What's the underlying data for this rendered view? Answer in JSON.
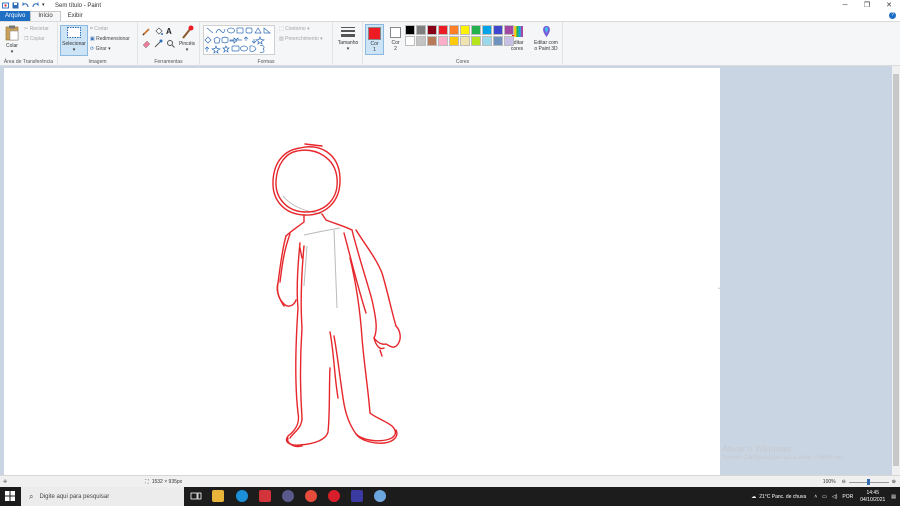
{
  "window": {
    "title": "Sem título - Paint"
  },
  "tabs": [
    "Arquivo",
    "Início",
    "Exibir"
  ],
  "ribbon": {
    "clipboard": {
      "paste": "Colar",
      "cut": "Recortar",
      "copy": "Copiar",
      "label": "Área de Transferência"
    },
    "image": {
      "select": "Selecionar",
      "crop": "Cortar",
      "resize": "Redimensionar",
      "rotate": "Girar",
      "label": "Imagem"
    },
    "tools": {
      "label": "Ferramentas",
      "brush": "Pincéis"
    },
    "shapes": {
      "outline": "Contorno",
      "fill": "Preenchimento",
      "label": "Formas"
    },
    "size": "Tamanho",
    "colors": {
      "color1_top": "Cor",
      "color1_num": "1",
      "color2_top": "Cor",
      "color2_num": "2",
      "label": "Cores",
      "edit_top": "Editar",
      "edit_bottom": "cores",
      "paint3d_top": "Editar com",
      "paint3d_bottom": "o Paint 3D",
      "color1_value": "#ed1c24",
      "color2_value": "#ffffff",
      "palette": [
        "#000000",
        "#7f7f7f",
        "#880015",
        "#ed1c24",
        "#ff7f27",
        "#fff200",
        "#22b14c",
        "#00a2e8",
        "#3f48cc",
        "#a349a4",
        "#ffffff",
        "#c3c3c3",
        "#b97a57",
        "#ffaec9",
        "#ffc90e",
        "#efe4b0",
        "#b5e61d",
        "#99d9ea",
        "#7092be",
        "#c8bfe7"
      ]
    }
  },
  "status": {
    "dimensions": "1532 × 935px",
    "zoom": "100%"
  },
  "watermark": {
    "line1": "Ativar o Windows",
    "line2": "Acesse Configurações para ativar o Windows."
  },
  "taskbar": {
    "search_placeholder": "Digite aqui para pesquisar",
    "weather": "21°C  Panc. de chuva",
    "lang": "POR",
    "time": "14:45",
    "date": "04/10/2021"
  }
}
